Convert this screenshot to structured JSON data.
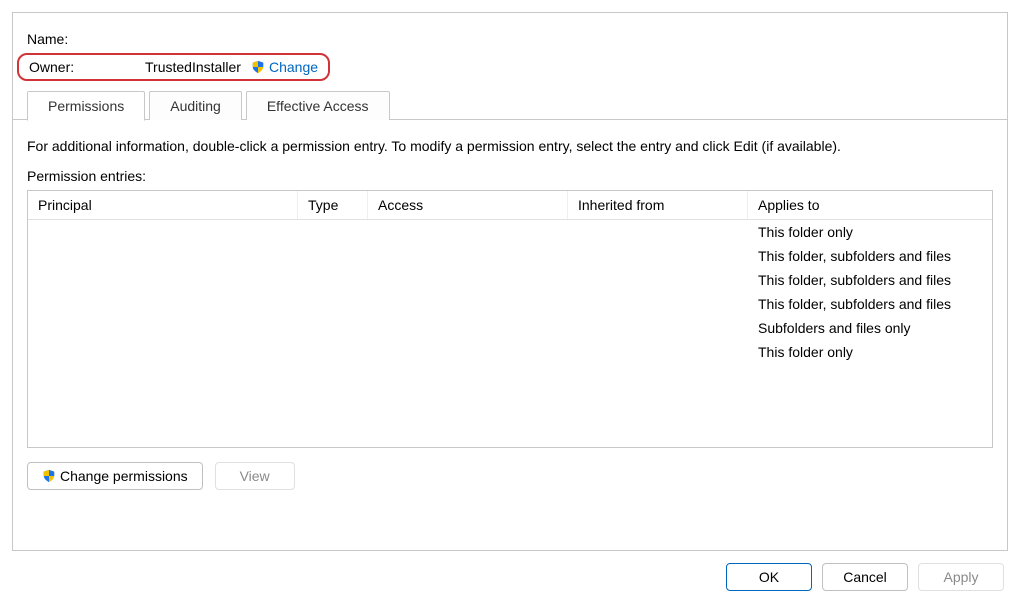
{
  "header": {
    "name_label": "Name:",
    "name_value": "",
    "owner_label": "Owner:",
    "owner_value": "TrustedInstaller",
    "change_link": "Change"
  },
  "tabs": [
    {
      "label": "Permissions",
      "active": true
    },
    {
      "label": "Auditing",
      "active": false
    },
    {
      "label": "Effective Access",
      "active": false
    }
  ],
  "body": {
    "instructions": "For additional information, double-click a permission entry. To modify a permission entry, select the entry and click Edit (if available).",
    "entries_label": "Permission entries:"
  },
  "grid": {
    "columns": [
      "Principal",
      "Type",
      "Access",
      "Inherited from",
      "Applies to"
    ],
    "rows": [
      {
        "principal": "",
        "type": "",
        "access": "",
        "inherited": "",
        "applies": "This folder only"
      },
      {
        "principal": "",
        "type": "",
        "access": "",
        "inherited": "",
        "applies": "This folder, subfolders and files"
      },
      {
        "principal": "",
        "type": "",
        "access": "",
        "inherited": "",
        "applies": "This folder, subfolders and files"
      },
      {
        "principal": "",
        "type": "",
        "access": "",
        "inherited": "",
        "applies": "This folder, subfolders and files"
      },
      {
        "principal": "",
        "type": "",
        "access": "",
        "inherited": "",
        "applies": "Subfolders and files only"
      },
      {
        "principal": "",
        "type": "",
        "access": "",
        "inherited": "",
        "applies": "This folder only"
      }
    ]
  },
  "buttons": {
    "change_permissions": "Change permissions",
    "view": "View",
    "ok": "OK",
    "cancel": "Cancel",
    "apply": "Apply"
  }
}
